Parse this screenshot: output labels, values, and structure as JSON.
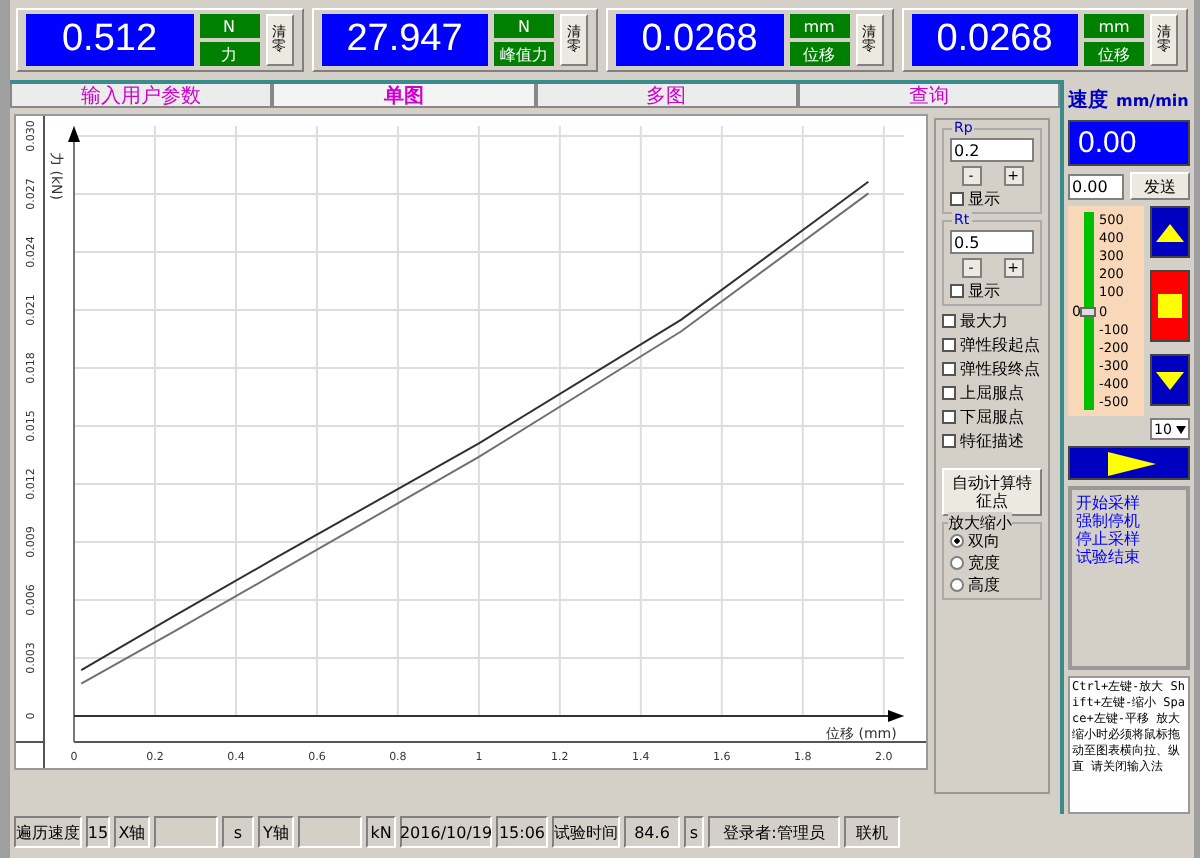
{
  "readouts": [
    {
      "value": "0.512",
      "unit": "N",
      "label": "力",
      "button": "清零"
    },
    {
      "value": "27.947",
      "unit": "N",
      "label": "峰值力",
      "button": "清零"
    },
    {
      "value": "0.0268",
      "unit": "mm",
      "label": "位移",
      "button": "清零"
    },
    {
      "value": "0.0268",
      "unit": "mm",
      "label": "位移",
      "button": "清零"
    }
  ],
  "tabs": [
    {
      "label": "输入用户参数",
      "selected": false
    },
    {
      "label": "单图",
      "selected": true
    },
    {
      "label": "多图",
      "selected": false
    },
    {
      "label": "查询",
      "selected": false
    }
  ],
  "chart": {
    "chart_data": {
      "type": "line",
      "xlabel": "位移 (mm)",
      "ylabel": "力 (kN)",
      "xlim": [
        0,
        2.05
      ],
      "ylim": [
        0,
        0.03
      ],
      "grid": true,
      "xticks": [
        {
          "value": 0,
          "label": "0"
        },
        {
          "value": 0.2,
          "label": "0.2"
        },
        {
          "value": 0.4,
          "label": "0.4"
        },
        {
          "value": 0.6,
          "label": "0.6"
        },
        {
          "value": 0.8,
          "label": "0.8"
        },
        {
          "value": 1,
          "label": "1"
        },
        {
          "value": 1.2,
          "label": "1.2"
        },
        {
          "value": 1.4,
          "label": "1.4"
        },
        {
          "value": 1.6,
          "label": "1.6"
        },
        {
          "value": 1.8,
          "label": "1.8"
        },
        {
          "value": 2,
          "label": "2.0"
        }
      ],
      "yticks": [
        {
          "value": 0,
          "label": "0"
        },
        {
          "value": 0.003,
          "label": "0.003"
        },
        {
          "value": 0.006,
          "label": "0.006"
        },
        {
          "value": 0.009,
          "label": "0.009"
        },
        {
          "value": 0.012,
          "label": "0.012"
        },
        {
          "value": 0.015,
          "label": "0.015"
        },
        {
          "value": 0.018,
          "label": "0.018"
        },
        {
          "value": 0.021,
          "label": "0.021"
        },
        {
          "value": 0.024,
          "label": "0.024"
        },
        {
          "value": 0.027,
          "label": "0.027"
        },
        {
          "value": 0.03,
          "label": "0.030"
        }
      ],
      "x": [
        0.02,
        0.25,
        0.5,
        1.0,
        1.5,
        1.96
      ],
      "series": [
        {
          "color": "#303030",
          "values": [
            0.0024,
            0.0052,
            0.0082,
            0.0141,
            0.0205,
            0.0276
          ]
        },
        {
          "color": "#707070",
          "values": [
            0.0017,
            0.0044,
            0.0074,
            0.0134,
            0.0199,
            0.027
          ]
        }
      ]
    }
  },
  "params": {
    "groups": [
      {
        "legend": "Rp",
        "value": "0.2",
        "minus": "-",
        "plus": "+",
        "show": {
          "label": "显示",
          "checked": false
        }
      },
      {
        "legend": "Rt",
        "value": "0.5",
        "minus": "-",
        "plus": "+",
        "show": {
          "label": "显示",
          "checked": false
        }
      }
    ],
    "checks": [
      {
        "label": "最大力",
        "checked": false
      },
      {
        "label": "弹性段起点",
        "checked": false
      },
      {
        "label": "弹性段终点",
        "checked": false
      },
      {
        "label": "上屈服点",
        "checked": false
      },
      {
        "label": "下屈服点",
        "checked": false
      },
      {
        "label": "特征描述",
        "checked": false
      }
    ],
    "auto_button": "自动计算特征点",
    "zoom_group": {
      "legend": "放大缩小",
      "options": [
        {
          "label": "双向",
          "selected": true
        },
        {
          "label": "宽度",
          "selected": false
        },
        {
          "label": "高度",
          "selected": false
        }
      ]
    }
  },
  "speed": {
    "title": "速度",
    "unit": "mm/min",
    "display": "0.00",
    "input": "0.00",
    "send": "发送",
    "scale": [
      "500",
      "400",
      "300",
      "200",
      "100",
      "0",
      "-100",
      "-200",
      "-300",
      "-400",
      "-500"
    ],
    "zero": "0",
    "slider": {
      "level": 0.5
    },
    "step": "10",
    "actions": [
      "开始采样",
      "强制停机",
      "停止采样",
      "试验结束"
    ],
    "help": "Ctrl+左键-放大 Shift+左键-缩小 Space+左键-平移 放大缩小时必须将鼠标拖动至图表横向拉、纵直 请关闭输入法"
  },
  "status_bar": [
    {
      "kind": "text",
      "text": "遍历速度"
    },
    {
      "kind": "text",
      "text": "15"
    },
    {
      "kind": "text",
      "text": "X轴"
    },
    {
      "kind": "blank"
    },
    {
      "kind": "text",
      "text": "s"
    },
    {
      "kind": "text",
      "text": "Y轴"
    },
    {
      "kind": "blank"
    },
    {
      "kind": "text",
      "text": "kN"
    },
    {
      "kind": "text",
      "text": "2016/10/19"
    },
    {
      "kind": "text",
      "text": "15:06"
    },
    {
      "kind": "text",
      "text": "试验时间"
    },
    {
      "kind": "text",
      "text": "84.6"
    },
    {
      "kind": "text",
      "text": "s"
    },
    {
      "kind": "text",
      "text": "登录者:管理员"
    },
    {
      "kind": "text",
      "text": "联机"
    }
  ]
}
